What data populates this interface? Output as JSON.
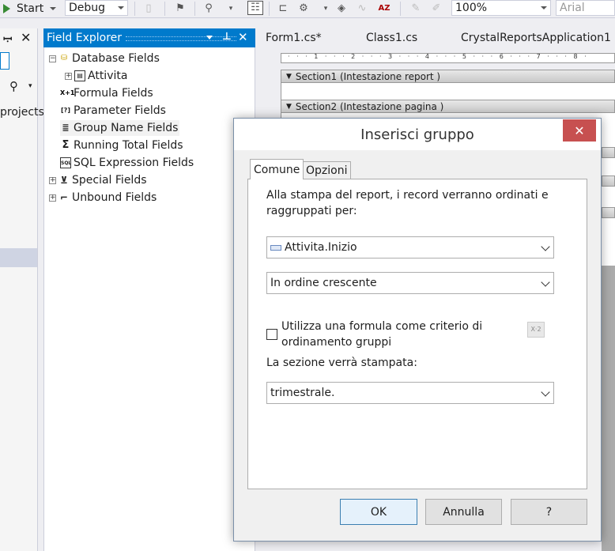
{
  "toolbar": {
    "start_label": "Start",
    "config_value": "Debug",
    "zoom_value": "100%",
    "font_value": "Arial"
  },
  "left_panel": {
    "search_text": "projects"
  },
  "field_explorer": {
    "title": "Field Explorer",
    "items": [
      {
        "label": "Database Fields",
        "icon": "database-icon"
      },
      {
        "label": "Attivita",
        "icon": "table-icon"
      },
      {
        "label": "Formula Fields",
        "icon": "formula-icon",
        "glyph": "X+1"
      },
      {
        "label": "Parameter Fields",
        "icon": "parameter-icon",
        "glyph": "[?]"
      },
      {
        "label": "Group Name Fields",
        "icon": "group-name-icon"
      },
      {
        "label": "Running Total Fields",
        "icon": "running-total-icon",
        "glyph": "Σ"
      },
      {
        "label": "SQL Expression Fields",
        "icon": "sql-icon",
        "glyph": "SQL"
      },
      {
        "label": "Special Fields",
        "icon": "special-icon"
      },
      {
        "label": "Unbound Fields",
        "icon": "unbound-icon"
      }
    ]
  },
  "editor": {
    "tabs": [
      "Form1.cs*",
      "Class1.cs",
      "CrystalReportsApplication1"
    ],
    "sections": [
      "Section1 (Intestazione report )",
      "Section2 (Intestazione pagina )"
    ]
  },
  "dialog": {
    "title": "Inserisci gruppo",
    "tabs": [
      "Comune",
      "Opzioni"
    ],
    "instruction": "Alla stampa del report, i record verranno ordinati e raggruppati per:",
    "group_field": "Attivita.Inizio",
    "sort_order": "In ordine crescente",
    "formula_checkbox_label": "Utilizza una formula come criterio di ordinamento gruppi",
    "formula_checked": false,
    "section_print_label": "La sezione verrà stampata:",
    "section_print_value": "trimestrale.",
    "ok_label": "OK",
    "cancel_label": "Annulla",
    "help_label": "?"
  },
  "colors": {
    "accent": "#007acc",
    "close": "#c75050"
  }
}
